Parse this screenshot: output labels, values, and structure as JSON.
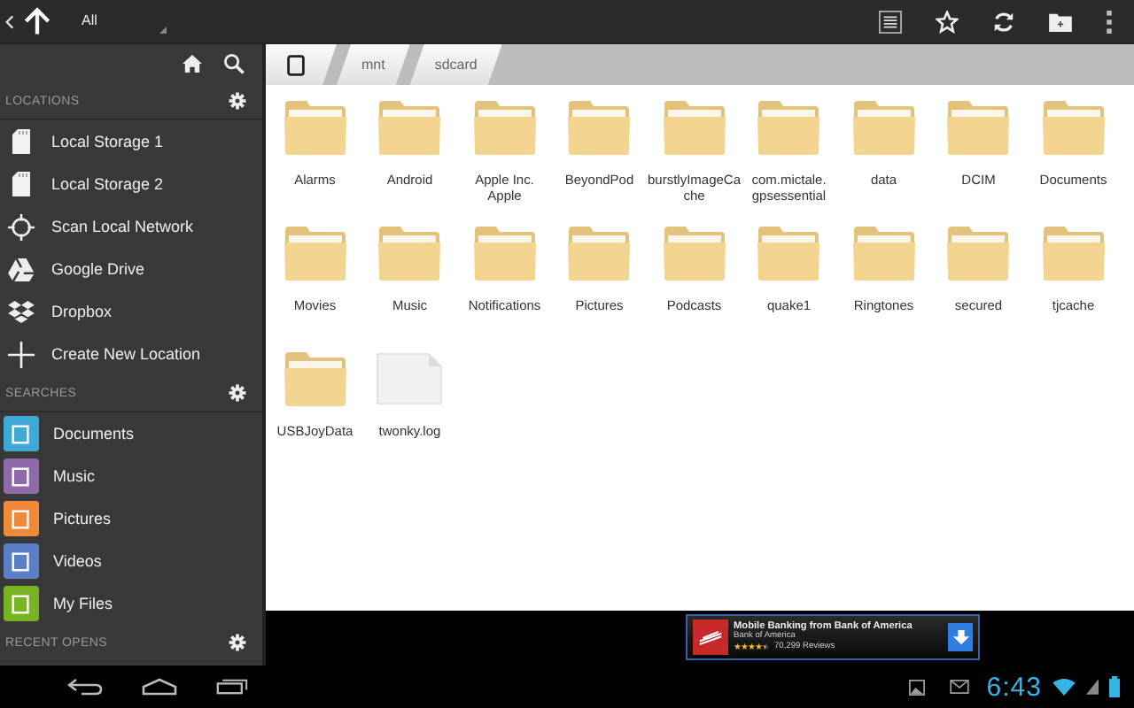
{
  "action_bar": {
    "spinner_label": "All"
  },
  "sidebar": {
    "sections": [
      {
        "title": "LOCATIONS",
        "items": [
          {
            "label": "Local Storage 1",
            "kind": "sdcard"
          },
          {
            "label": "Local Storage 2",
            "kind": "sdcard"
          },
          {
            "label": "Scan Local Network",
            "kind": "scan"
          },
          {
            "label": "Google Drive",
            "kind": "drive"
          },
          {
            "label": "Dropbox",
            "kind": "dropbox"
          },
          {
            "label": "Create New Location",
            "kind": "add"
          }
        ]
      },
      {
        "title": "SEARCHES",
        "items": [
          {
            "label": "Documents",
            "kind": "tile",
            "color": "#3fa9d8"
          },
          {
            "label": "Music",
            "kind": "tile",
            "color": "#8e6ba8"
          },
          {
            "label": "Pictures",
            "kind": "tile",
            "color": "#ef8a3a"
          },
          {
            "label": "Videos",
            "kind": "tile",
            "color": "#5b7fc7"
          },
          {
            "label": "My Files",
            "kind": "tile",
            "color": "#78b324"
          }
        ]
      },
      {
        "title": "RECENT OPENS"
      }
    ]
  },
  "breadcrumb": [
    "mnt",
    "sdcard"
  ],
  "files": [
    {
      "name": "Alarms",
      "kind": "folder"
    },
    {
      "name": "Android",
      "kind": "folder"
    },
    {
      "name": "Apple Inc. Apple",
      "kind": "folder"
    },
    {
      "name": "BeyondPod",
      "kind": "folder"
    },
    {
      "name": "burstlyImageCache",
      "kind": "folder"
    },
    {
      "name": "com.mictale. gpsessential",
      "kind": "folder"
    },
    {
      "name": "data",
      "kind": "folder"
    },
    {
      "name": "DCIM",
      "kind": "folder"
    },
    {
      "name": "Documents",
      "kind": "folder"
    },
    {
      "name": "Movies",
      "kind": "folder"
    },
    {
      "name": "Music",
      "kind": "folder"
    },
    {
      "name": "Notifications",
      "kind": "folder"
    },
    {
      "name": "Pictures",
      "kind": "folder"
    },
    {
      "name": "Podcasts",
      "kind": "folder"
    },
    {
      "name": "quake1",
      "kind": "folder"
    },
    {
      "name": "Ringtones",
      "kind": "folder"
    },
    {
      "name": "secured",
      "kind": "folder"
    },
    {
      "name": "tjcache",
      "kind": "folder"
    },
    {
      "name": "USBJoyData",
      "kind": "folder"
    },
    {
      "name": "twonky.log",
      "kind": "file"
    }
  ],
  "ad": {
    "title": "Mobile Banking from Bank of America",
    "subtitle": "Bank of America",
    "stars": 4.5,
    "reviews": "70,299 Reviews"
  },
  "status_bar": {
    "time": "6:43"
  }
}
